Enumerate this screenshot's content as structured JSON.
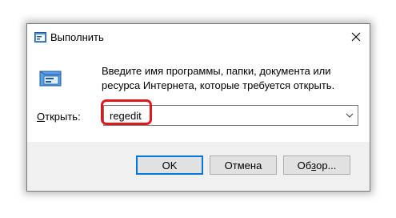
{
  "window": {
    "title": "Выполнить",
    "close_icon": "close-icon"
  },
  "content": {
    "description": "Введите имя программы, папки, документа или ресурса Интернета, которые требуется открыть.",
    "open_label_accel": "О",
    "open_label_rest": "ткрыть:",
    "input_value": "regedit",
    "highlight_color": "#e0181b"
  },
  "buttons": {
    "ok": "OK",
    "cancel": "Отмена",
    "browse_pre": "Об",
    "browse_accel": "з",
    "browse_post": "ор..."
  },
  "colors": {
    "accent": "#0078d7",
    "footer_bg": "#f0f0f0"
  }
}
